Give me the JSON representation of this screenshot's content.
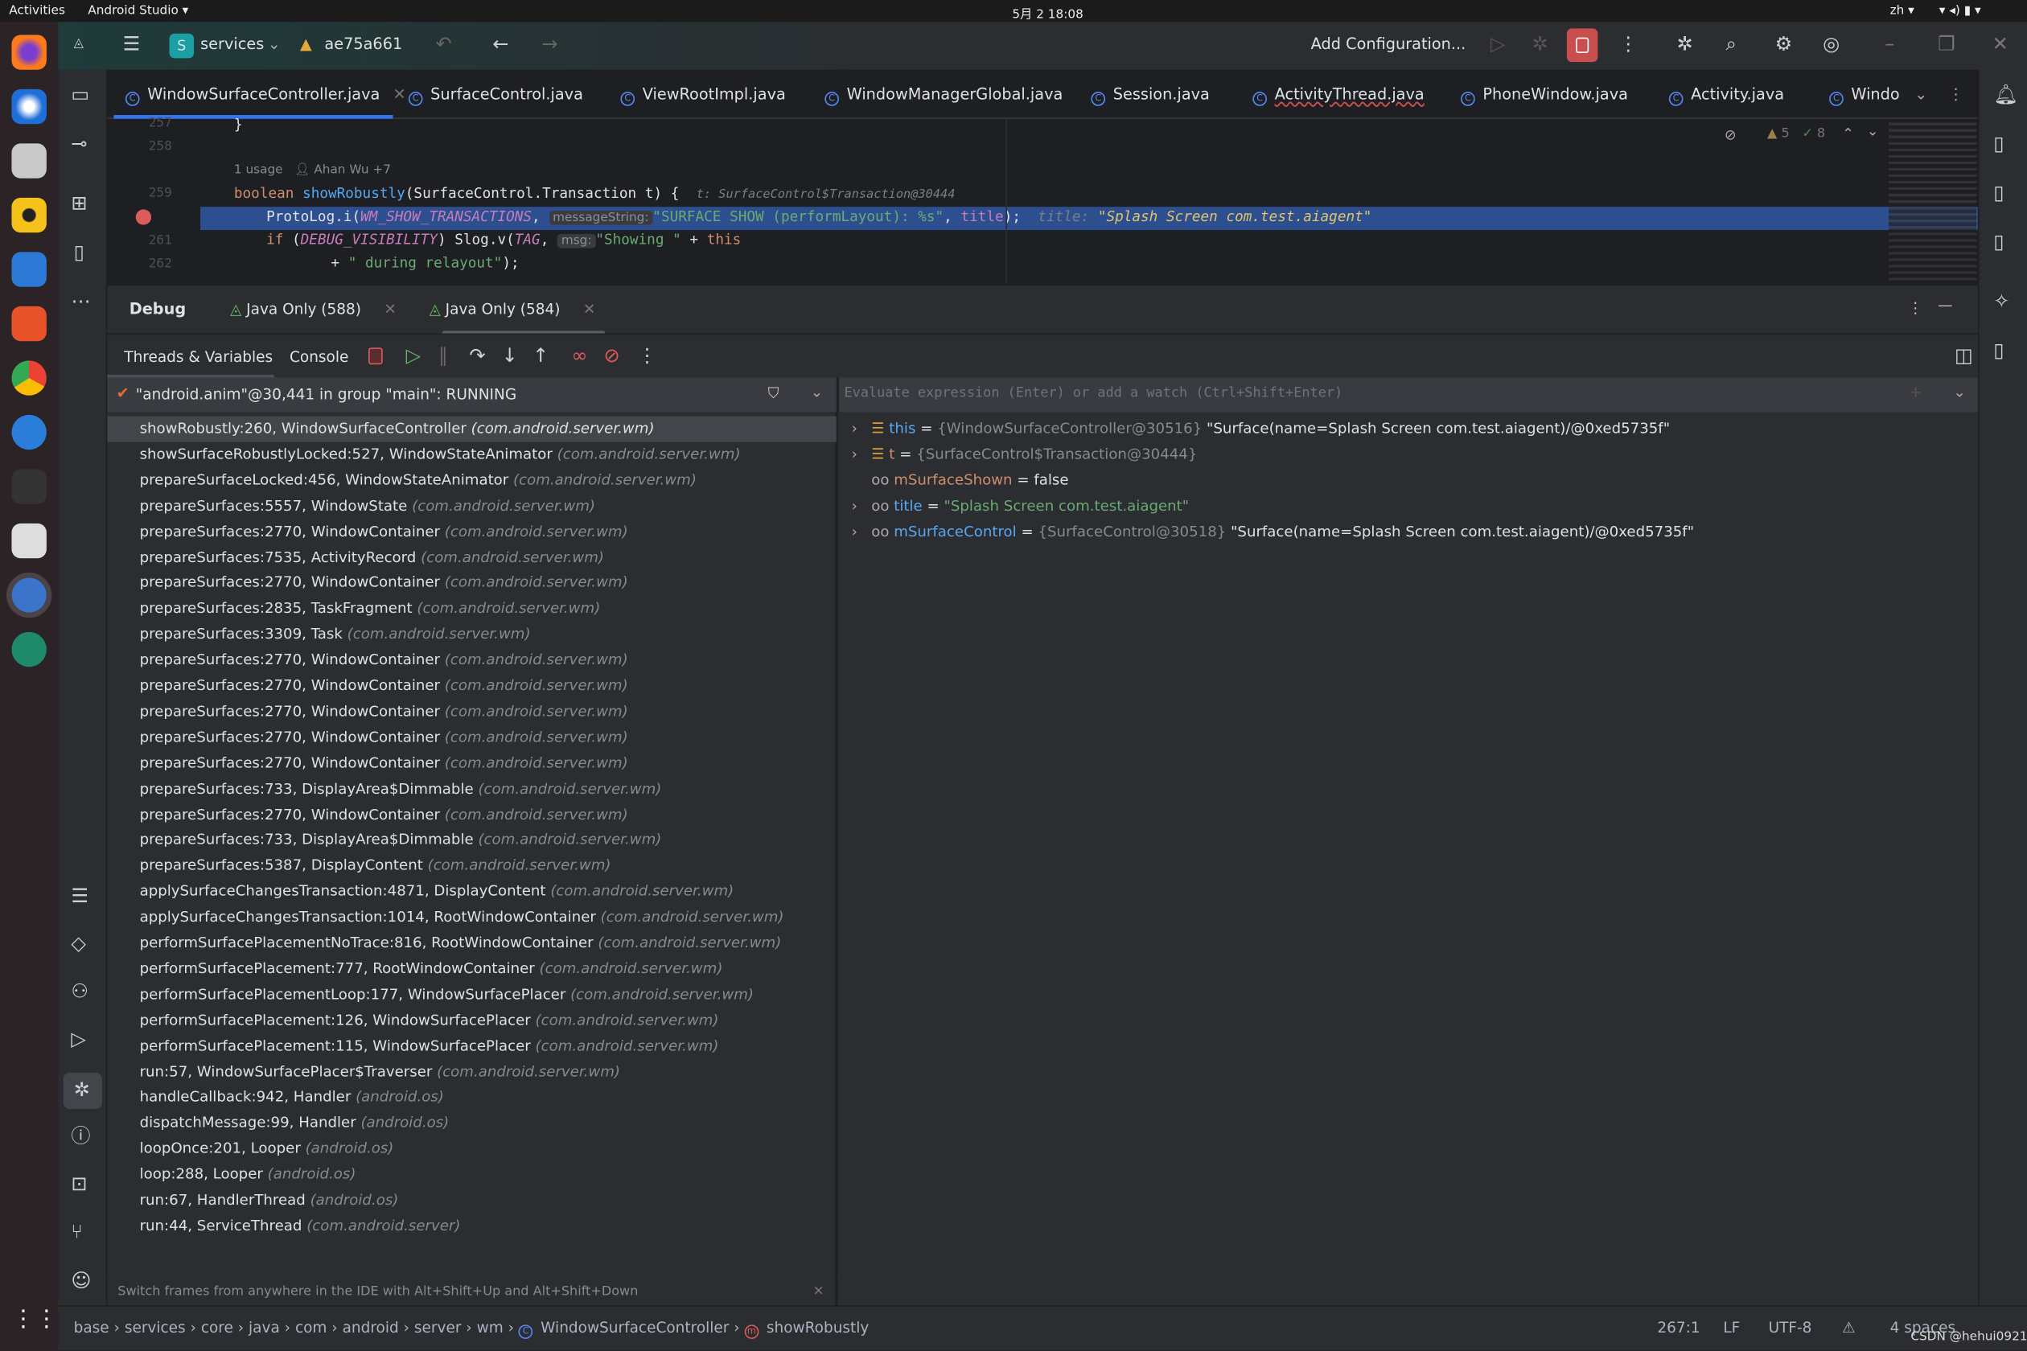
{
  "system_bar": {
    "activities": "Activities",
    "app": "Android Studio ▾",
    "clock": "5月 2  18:08",
    "lang": "zh ▾"
  },
  "toolbar": {
    "project_badge": "S",
    "project": "services",
    "branch": "ae75a661",
    "run_config": "Add Configuration...",
    "accent": "#c94f4f"
  },
  "tabs": [
    {
      "label": "WindowSurfaceController.java",
      "active": true
    },
    {
      "label": "SurfaceControl.java"
    },
    {
      "label": "ViewRootImpl.java"
    },
    {
      "label": "WindowManagerGlobal.java"
    },
    {
      "label": "Session.java"
    },
    {
      "label": "ActivityThread.java"
    },
    {
      "label": "PhoneWindow.java"
    },
    {
      "label": "Activity.java"
    },
    {
      "label": "Windo"
    }
  ],
  "editor": {
    "warnings": "5",
    "checks": "8",
    "usage": "1 usage",
    "author": "Ahan Wu +7",
    "lines": {
      "l257": "257",
      "l258": "258",
      "l259": "259",
      "l261": "261",
      "l262": "262"
    },
    "code": {
      "c257": "}",
      "c259_kw": "boolean ",
      "c259_fn": "showRobustly",
      "c259_rest": "(SurfaceControl.Transaction t) {",
      "c259_hint": "t: SurfaceControl$Transaction@30444",
      "c260_a": "ProtoLog.i(",
      "c260_const": "WM_SHOW_TRANSACTIONS",
      "c260_b": ", ",
      "c260_param": "messageString:",
      "c260_str": "\"SURFACE SHOW (performLayout): %s\"",
      "c260_c": ", ",
      "c260_title": "title",
      "c260_d": ");",
      "c260_hint_k": "title: ",
      "c260_hint_v": "\"Splash Screen com.test.aiagent\"",
      "c261_kw": "if ",
      "c261_a": "(",
      "c261_const": "DEBUG_VISIBILITY",
      "c261_b": ") Slog.v(",
      "c261_tag": "TAG",
      "c261_c": ", ",
      "c261_param": "msg:",
      "c261_str": "\"Showing \"",
      "c261_d": " + ",
      "c261_this": "this",
      "c262_a": "+ ",
      "c262_str": "\" during relayout\"",
      "c262_b": ");"
    }
  },
  "debug": {
    "title": "Debug",
    "sessions": [
      {
        "label": "Java Only (588)"
      },
      {
        "label": "Java Only (584)",
        "active": true
      }
    ],
    "tabs": {
      "threads": "Threads & Variables",
      "console": "Console"
    },
    "thread": "\"android.anim\"@30,441 in group \"main\": RUNNING",
    "eval_placeholder": "Evaluate expression (Enter) or add a watch (Ctrl+Shift+Enter)",
    "frames": [
      {
        "m": "showRobustly:260, WindowSurfaceController",
        "p": "(com.android.server.wm)"
      },
      {
        "m": "showSurfaceRobustlyLocked:527, WindowStateAnimator",
        "p": "(com.android.server.wm)"
      },
      {
        "m": "prepareSurfaceLocked:456, WindowStateAnimator",
        "p": "(com.android.server.wm)"
      },
      {
        "m": "prepareSurfaces:5557, WindowState",
        "p": "(com.android.server.wm)"
      },
      {
        "m": "prepareSurfaces:2770, WindowContainer",
        "p": "(com.android.server.wm)"
      },
      {
        "m": "prepareSurfaces:7535, ActivityRecord",
        "p": "(com.android.server.wm)"
      },
      {
        "m": "prepareSurfaces:2770, WindowContainer",
        "p": "(com.android.server.wm)"
      },
      {
        "m": "prepareSurfaces:2835, TaskFragment",
        "p": "(com.android.server.wm)"
      },
      {
        "m": "prepareSurfaces:3309, Task",
        "p": "(com.android.server.wm)"
      },
      {
        "m": "prepareSurfaces:2770, WindowContainer",
        "p": "(com.android.server.wm)"
      },
      {
        "m": "prepareSurfaces:2770, WindowContainer",
        "p": "(com.android.server.wm)"
      },
      {
        "m": "prepareSurfaces:2770, WindowContainer",
        "p": "(com.android.server.wm)"
      },
      {
        "m": "prepareSurfaces:2770, WindowContainer",
        "p": "(com.android.server.wm)"
      },
      {
        "m": "prepareSurfaces:2770, WindowContainer",
        "p": "(com.android.server.wm)"
      },
      {
        "m": "prepareSurfaces:733, DisplayArea$Dimmable",
        "p": "(com.android.server.wm)"
      },
      {
        "m": "prepareSurfaces:2770, WindowContainer",
        "p": "(com.android.server.wm)"
      },
      {
        "m": "prepareSurfaces:733, DisplayArea$Dimmable",
        "p": "(com.android.server.wm)"
      },
      {
        "m": "prepareSurfaces:5387, DisplayContent",
        "p": "(com.android.server.wm)"
      },
      {
        "m": "applySurfaceChangesTransaction:4871, DisplayContent",
        "p": "(com.android.server.wm)"
      },
      {
        "m": "applySurfaceChangesTransaction:1014, RootWindowContainer",
        "p": "(com.android.server.wm)"
      },
      {
        "m": "performSurfacePlacementNoTrace:816, RootWindowContainer",
        "p": "(com.android.server.wm)"
      },
      {
        "m": "performSurfacePlacement:777, RootWindowContainer",
        "p": "(com.android.server.wm)"
      },
      {
        "m": "performSurfacePlacementLoop:177, WindowSurfacePlacer",
        "p": "(com.android.server.wm)"
      },
      {
        "m": "performSurfacePlacement:126, WindowSurfacePlacer",
        "p": "(com.android.server.wm)"
      },
      {
        "m": "performSurfacePlacement:115, WindowSurfacePlacer",
        "p": "(com.android.server.wm)"
      },
      {
        "m": "run:57, WindowSurfacePlacer$Traverser",
        "p": "(com.android.server.wm)"
      },
      {
        "m": "handleCallback:942, Handler",
        "p": "(android.os)"
      },
      {
        "m": "dispatchMessage:99, Handler",
        "p": "(android.os)"
      },
      {
        "m": "loopOnce:201, Looper",
        "p": "(android.os)"
      },
      {
        "m": "loop:288, Looper",
        "p": "(android.os)"
      },
      {
        "m": "run:67, HandlerThread",
        "p": "(android.os)"
      },
      {
        "m": "run:44, ServiceThread",
        "p": "(com.android.server)"
      }
    ],
    "variables": [
      {
        "name": "this",
        "kind": "field",
        "expandable": true,
        "eq": " = ",
        "type": "{WindowSurfaceController@30516}",
        "value": " \"Surface(name=Splash Screen com.test.aiagent)/@0xed5735f\""
      },
      {
        "name": "t",
        "kind": "param",
        "expandable": true,
        "eq": " = ",
        "type": "{SurfaceControl$Transaction@30444}",
        "value": ""
      },
      {
        "name": "mSurfaceShown",
        "kind": "watch",
        "expandable": false,
        "eq": " = ",
        "type": "",
        "value": "false"
      },
      {
        "name": "title",
        "kind": "watch",
        "expandable": true,
        "eq": " = ",
        "type": "",
        "value": "\"Splash Screen com.test.aiagent\""
      },
      {
        "name": "mSurfaceControl",
        "kind": "watch",
        "expandable": true,
        "eq": " = ",
        "type": "{SurfaceControl@30518}",
        "value": " \"Surface(name=Splash Screen com.test.aiagent)/@0xed5735f\""
      }
    ],
    "tip": "Switch frames from anywhere in the IDE with Alt+Shift+Up and Alt+Shift+Down"
  },
  "status": {
    "breadcrumb": [
      "base",
      "services",
      "core",
      "java",
      "com",
      "android",
      "server",
      "wm",
      "WindowSurfaceController",
      "showRobustly"
    ],
    "position": "267:1",
    "line_sep": "LF",
    "encoding": "UTF-8",
    "indent": "4 spaces",
    "watermark": "CSDN @hehui0921"
  }
}
